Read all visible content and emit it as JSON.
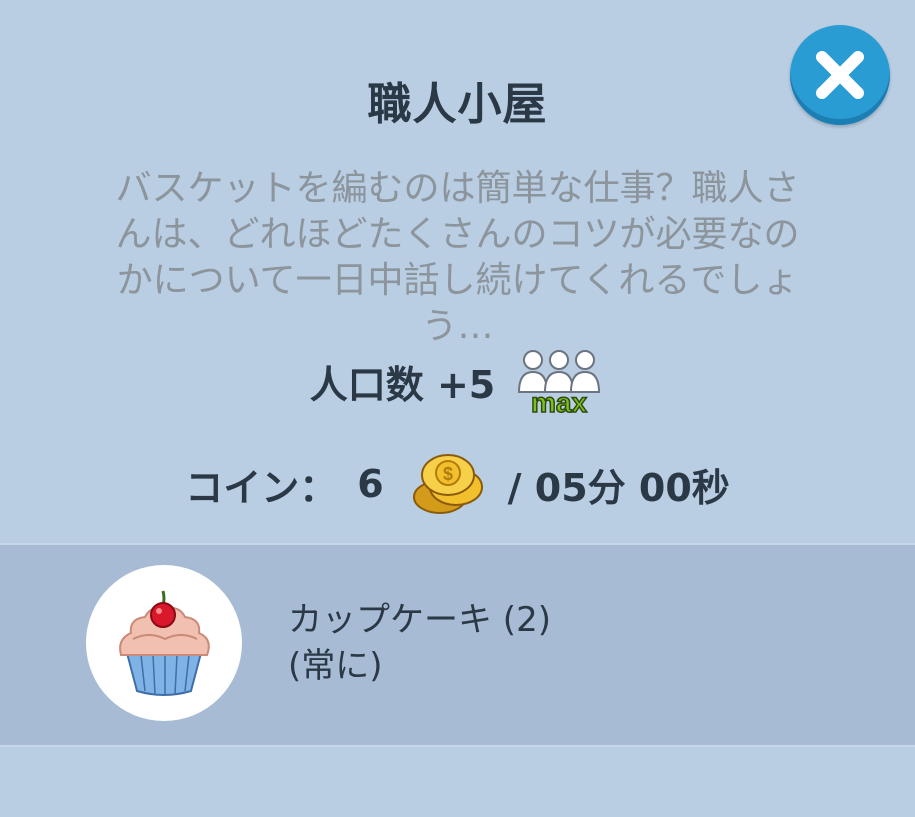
{
  "dialog": {
    "title": "職人小屋",
    "close_icon": "close-icon",
    "description": "バスケットを編むのは簡単な仕事？職人さんは、どれほどたくさんのコツが必要なのかについて一日中話し続けてくれるでしょう…"
  },
  "population": {
    "label": "人口数 +5",
    "icon": "people-icon",
    "badge": "max"
  },
  "coins": {
    "label": "コイン：",
    "amount": "6",
    "icon": "coin-stack-icon",
    "duration": "/ 05分 00秒"
  },
  "product": {
    "icon": "cupcake-icon",
    "name": "カップケーキ (2)",
    "availability": "(常に)"
  },
  "colors": {
    "background": "#b9cde3",
    "band": "#a7bcd4",
    "close_button": "#2a9cd4",
    "max_badge": "#7cc21e"
  }
}
